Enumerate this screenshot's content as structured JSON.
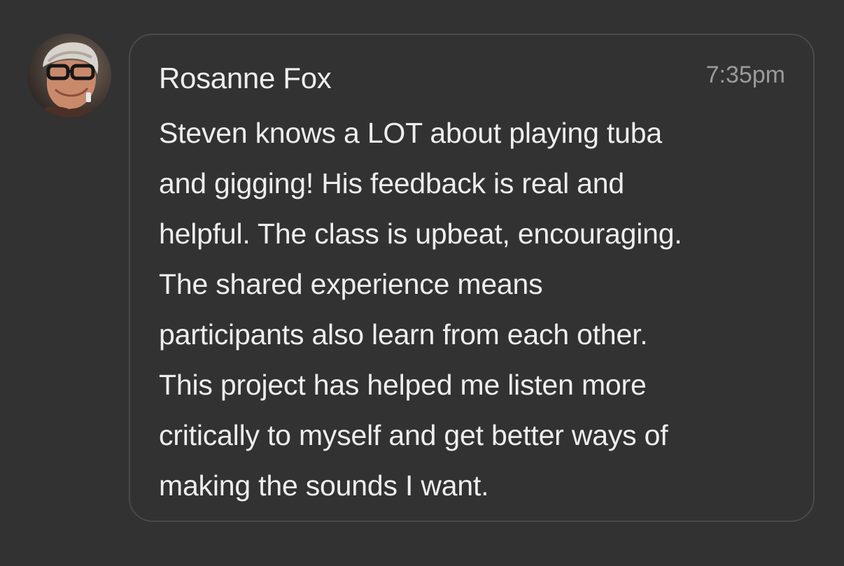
{
  "message": {
    "author": "Rosanne Fox",
    "time": "7:35pm",
    "lines": [
      "Steven knows a LOT about playing tuba",
      "and gigging! His feedback is real and",
      "helpful. The class is upbeat, encouraging.",
      "The shared experience means",
      "participants also learn from each other.",
      "This project has helped me listen more",
      "critically to myself and get better ways of",
      "making the sounds I want."
    ]
  },
  "colors": {
    "background": "#323232",
    "bubble_border": "#4a4a4a",
    "text": "#eeeeee",
    "time": "#9a9a9a"
  }
}
